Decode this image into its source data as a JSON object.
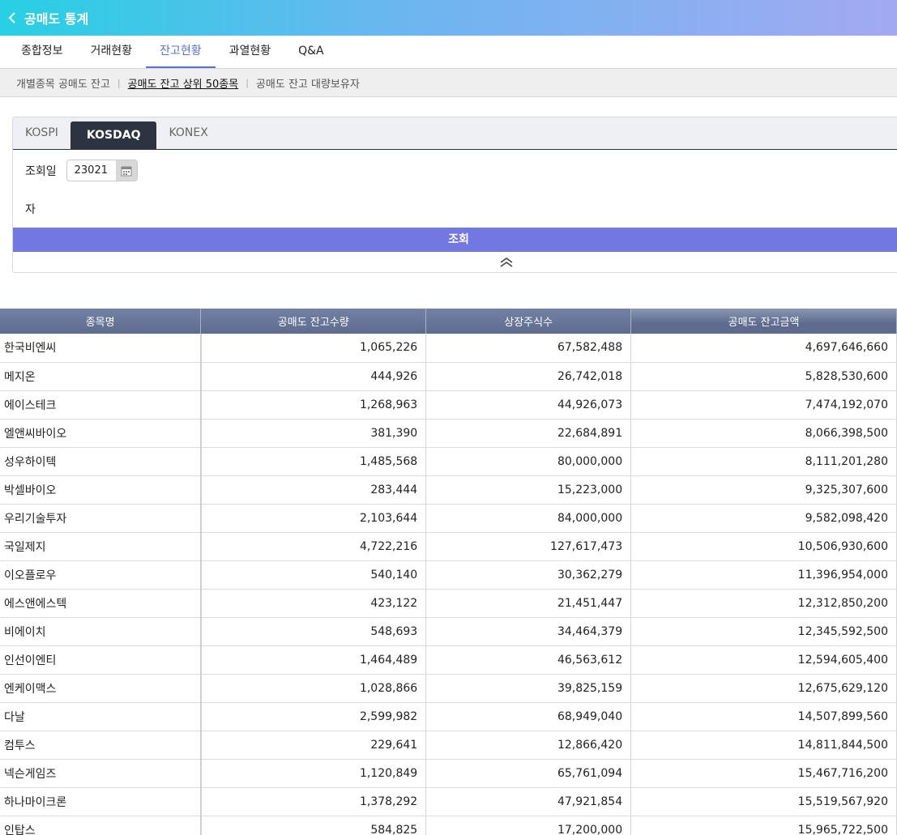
{
  "header": {
    "title": "공매도 통계"
  },
  "tabs": [
    {
      "label": "종합정보"
    },
    {
      "label": "거래현황"
    },
    {
      "label": "잔고현황"
    },
    {
      "label": "과열현황"
    },
    {
      "label": "Q&A"
    }
  ],
  "subnav": [
    {
      "label": "개별종목 공매도 잔고"
    },
    {
      "label": "공매도 잔고 상위 50종목"
    },
    {
      "label": "공매도 잔고 대량보유자"
    }
  ],
  "search": {
    "markets": [
      "KOSPI",
      "KOSDAQ",
      "KONEX"
    ],
    "date_label": "조회일",
    "date_value": "23021",
    "suffix": "자",
    "button_label": "조회"
  },
  "table": {
    "headers": [
      "종목명",
      "공매도 잔고수량",
      "상장주식수",
      "공매도 잔고금액"
    ],
    "rows": [
      [
        "한국비엔씨",
        "1,065,226",
        "67,582,488",
        "4,697,646,660"
      ],
      [
        "메지온",
        "444,926",
        "26,742,018",
        "5,828,530,600"
      ],
      [
        "에이스테크",
        "1,268,963",
        "44,926,073",
        "7,474,192,070"
      ],
      [
        "엘앤씨바이오",
        "381,390",
        "22,684,891",
        "8,066,398,500"
      ],
      [
        "성우하이텍",
        "1,485,568",
        "80,000,000",
        "8,111,201,280"
      ],
      [
        "박셀바이오",
        "283,444",
        "15,223,000",
        "9,325,307,600"
      ],
      [
        "우리기술투자",
        "2,103,644",
        "84,000,000",
        "9,582,098,420"
      ],
      [
        "국일제지",
        "4,722,216",
        "127,617,473",
        "10,506,930,600"
      ],
      [
        "이오플로우",
        "540,140",
        "30,362,279",
        "11,396,954,000"
      ],
      [
        "에스앤에스텍",
        "423,122",
        "21,451,447",
        "12,312,850,200"
      ],
      [
        "비에이치",
        "548,693",
        "34,464,379",
        "12,345,592,500"
      ],
      [
        "인선이엔티",
        "1,464,489",
        "46,563,612",
        "12,594,605,400"
      ],
      [
        "엔케이맥스",
        "1,028,866",
        "39,825,159",
        "12,675,629,120"
      ],
      [
        "다날",
        "2,599,982",
        "68,949,040",
        "14,507,899,560"
      ],
      [
        "컴투스",
        "229,641",
        "12,866,420",
        "14,811,844,500"
      ],
      [
        "넥슨게임즈",
        "1,120,849",
        "65,761,094",
        "15,467,716,200"
      ],
      [
        "하나마이크론",
        "1,378,292",
        "47,921,854",
        "15,519,567,920"
      ],
      [
        "인탑스",
        "584,825",
        "17,200,000",
        "15,965,722,500"
      ]
    ]
  }
}
